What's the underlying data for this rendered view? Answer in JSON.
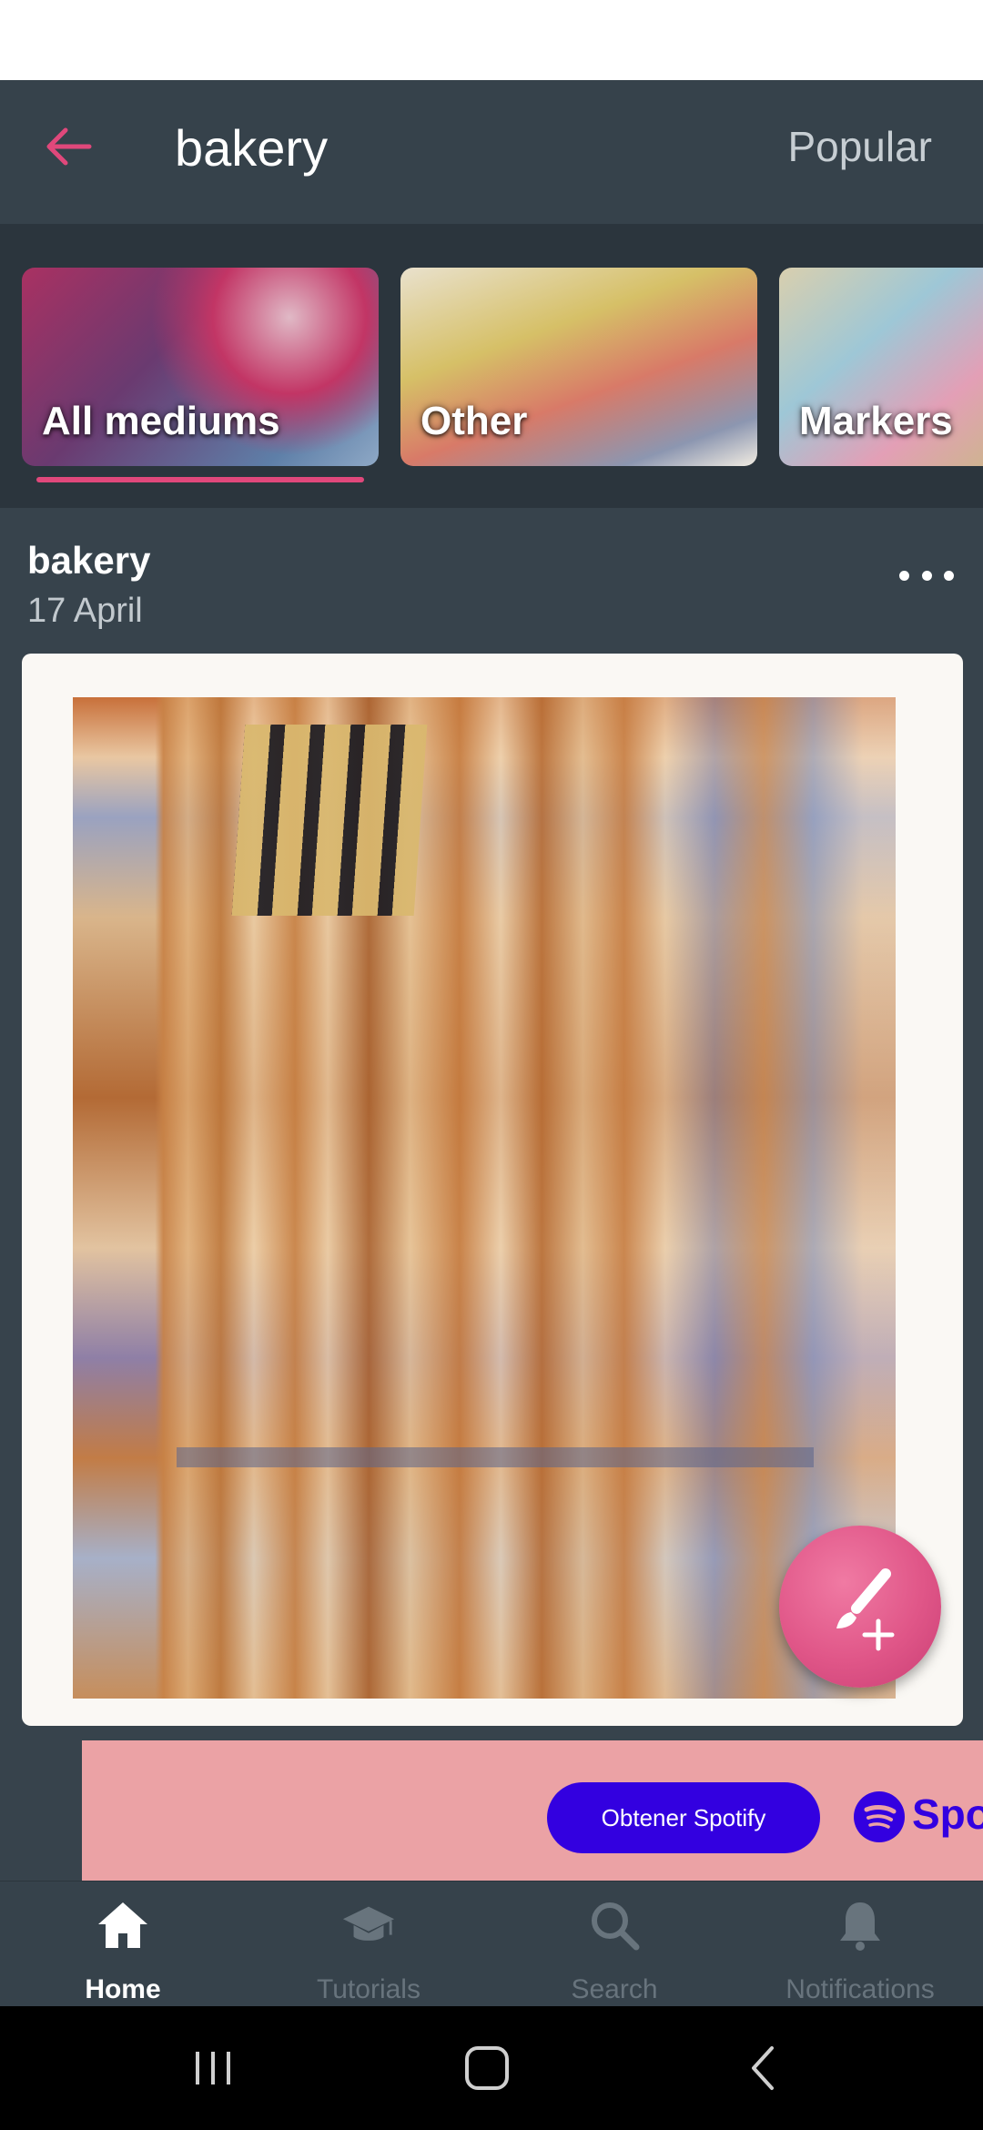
{
  "header": {
    "search_query": "bakery",
    "sort_label": "Popular"
  },
  "mediums": {
    "items": [
      {
        "label": "All mediums",
        "selected": true
      },
      {
        "label": "Other",
        "selected": false
      },
      {
        "label": "Markers",
        "selected": false
      }
    ]
  },
  "post": {
    "title": "bakery",
    "date": "17 April",
    "image_description_icon": "watercolor-artwork"
  },
  "ad": {
    "cta_label": "Obtener Spotify",
    "brand": "Spotify",
    "background_color": "#eba2a5",
    "accent_color": "#3300e0"
  },
  "fab": {
    "icon": "brush-plus-icon",
    "color": "#e05688"
  },
  "bottom_nav": {
    "items": [
      {
        "label": "Home",
        "icon": "home-icon",
        "active": true
      },
      {
        "label": "Tutorials",
        "icon": "graduation-cap-icon",
        "active": false
      },
      {
        "label": "Search",
        "icon": "search-icon",
        "active": false
      },
      {
        "label": "Notifications",
        "icon": "bell-icon",
        "active": false
      }
    ]
  },
  "colors": {
    "accent": "#e0487b",
    "background": "#37434c",
    "bar": "#36424b"
  }
}
